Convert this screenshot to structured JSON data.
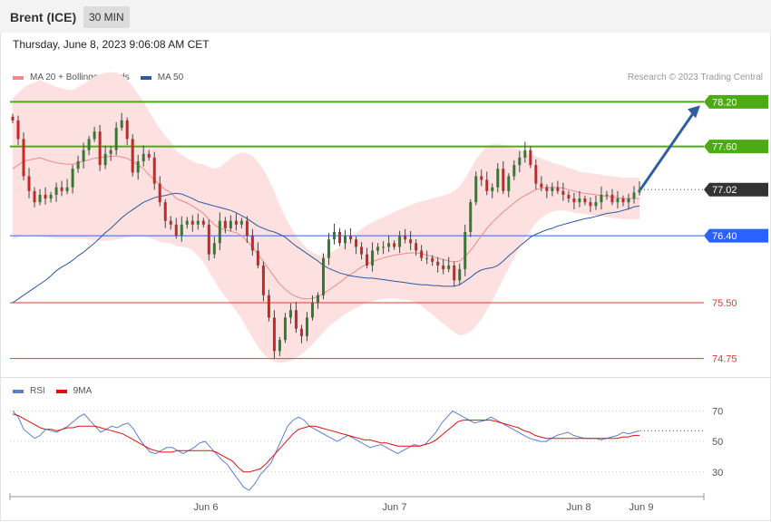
{
  "header": {
    "title": "Brent (ICE)",
    "timeframe": "30 MIN",
    "datetime": "Thursday, June 8, 2023 9:06:08 AM CET"
  },
  "legend_main": [
    {
      "label": "MA 20 + Bollinger Bands",
      "color": "#f08a8a"
    },
    {
      "label": "MA 50",
      "color": "#2c5aa0"
    }
  ],
  "copyright": "Research © 2023 Trading Central",
  "legend_rsi": [
    {
      "label": "RSI",
      "color": "#5b7fd6"
    },
    {
      "label": "9MA",
      "color": "#e01010"
    }
  ],
  "chart_data": [
    {
      "type": "candlestick",
      "title": "",
      "ylim": [
        74.55,
        78.35
      ],
      "x_ticks": [
        "Jun 6",
        "Jun 7",
        "Jun 8",
        "Jun 9"
      ],
      "levels": [
        {
          "value": 78.2,
          "label": "78.20",
          "color": "#4caa14",
          "kind": "resistance"
        },
        {
          "value": 77.6,
          "label": "77.60",
          "color": "#4caa14",
          "kind": "resistance"
        },
        {
          "value": 77.02,
          "label": "77.02",
          "color": "#333333",
          "kind": "last"
        },
        {
          "value": 76.4,
          "label": "76.40",
          "color": "#2962ff",
          "kind": "pivot"
        },
        {
          "value": 75.5,
          "label": "75.50",
          "color": "#e53935",
          "kind": "support"
        },
        {
          "value": 74.75,
          "label": "74.75",
          "color": "#e53935",
          "kind": "support"
        }
      ],
      "close": [
        77.95,
        77.7,
        77.2,
        77.0,
        76.85,
        76.95,
        76.9,
        76.95,
        77.05,
        77.0,
        77.05,
        77.3,
        77.4,
        77.55,
        77.7,
        77.8,
        77.35,
        77.5,
        77.55,
        77.85,
        77.95,
        77.7,
        77.25,
        77.4,
        77.5,
        77.45,
        77.1,
        76.85,
        76.6,
        76.55,
        76.4,
        76.55,
        76.6,
        76.55,
        76.6,
        76.55,
        76.15,
        76.3,
        76.6,
        76.5,
        76.6,
        76.55,
        76.6,
        76.4,
        76.2,
        76.0,
        75.6,
        75.3,
        74.85,
        75.0,
        75.3,
        75.4,
        75.15,
        75.05,
        75.3,
        75.5,
        75.6,
        76.1,
        76.35,
        76.45,
        76.3,
        76.4,
        76.35,
        76.25,
        76.15,
        76.0,
        76.2,
        76.25,
        76.25,
        76.3,
        76.25,
        76.4,
        76.35,
        76.3,
        76.2,
        76.1,
        76.1,
        76.05,
        76.0,
        75.95,
        76.0,
        75.8,
        75.95,
        76.45,
        76.85,
        77.2,
        77.15,
        77.0,
        77.05,
        77.3,
        77.0,
        77.2,
        77.35,
        77.45,
        77.55,
        77.35,
        77.1,
        77.05,
        77.0,
        77.05,
        77.0,
        76.95,
        76.9,
        76.85,
        76.9,
        76.85,
        76.8,
        76.85,
        76.95,
        76.95,
        76.85,
        76.9,
        76.85,
        76.9,
        76.98,
        77.02
      ],
      "ma50": [
        75.5,
        75.55,
        75.6,
        75.65,
        75.7,
        75.75,
        75.8,
        75.86,
        75.93,
        75.98,
        76.02,
        76.07,
        76.13,
        76.18,
        76.24,
        76.3,
        76.37,
        76.44,
        76.5,
        76.57,
        76.64,
        76.7,
        76.75,
        76.8,
        76.85,
        76.88,
        76.91,
        76.93,
        76.94,
        76.96,
        76.97,
        76.96,
        76.93,
        76.9,
        76.86,
        76.84,
        76.82,
        76.8,
        76.78,
        76.76,
        76.74,
        76.71,
        76.67,
        76.63,
        76.58,
        76.53,
        76.5,
        76.47,
        76.45,
        76.42,
        76.38,
        76.32,
        76.26,
        76.21,
        76.16,
        76.11,
        76.06,
        76.0,
        75.96,
        75.93,
        75.9,
        75.88,
        75.86,
        75.85,
        75.84,
        75.83,
        75.83,
        75.82,
        75.81,
        75.8,
        75.79,
        75.78,
        75.77,
        75.76,
        75.75,
        75.74,
        75.74,
        75.73,
        75.73,
        75.72,
        75.72,
        75.72,
        75.74,
        75.79,
        75.84,
        75.9,
        75.94,
        75.96,
        75.97,
        76.0,
        76.06,
        76.13,
        76.19,
        76.26,
        76.32,
        76.38,
        76.42,
        76.45,
        76.48,
        76.5,
        76.53,
        76.55,
        76.57,
        76.59,
        76.61,
        76.63,
        76.64,
        76.66,
        76.68,
        76.7,
        76.71,
        76.72,
        76.74,
        76.76,
        76.79,
        76.8
      ],
      "ma20": [
        77.3,
        77.35,
        77.4,
        77.42,
        77.43,
        77.45,
        77.42,
        77.4,
        77.38,
        77.37,
        77.36,
        77.36,
        77.38,
        77.4,
        77.42,
        77.44,
        77.45,
        77.46,
        77.47,
        77.47,
        77.46,
        77.44,
        77.4,
        77.35,
        77.3,
        77.22,
        77.15,
        77.08,
        77.02,
        76.98,
        76.9,
        76.87,
        76.84,
        76.8,
        76.75,
        76.7,
        76.62,
        76.55,
        76.5,
        76.48,
        76.46,
        76.44,
        76.4,
        76.33,
        76.25,
        76.15,
        76.05,
        75.95,
        75.85,
        75.75,
        75.68,
        75.62,
        75.58,
        75.56,
        75.55,
        75.56,
        75.58,
        75.62,
        75.67,
        75.72,
        75.77,
        75.83,
        75.88,
        75.93,
        75.98,
        76.02,
        76.05,
        76.08,
        76.1,
        76.12,
        76.14,
        76.15,
        76.16,
        76.17,
        76.17,
        76.16,
        76.14,
        76.12,
        76.1,
        76.08,
        76.06,
        76.05,
        76.06,
        76.12,
        76.2,
        76.3,
        76.4,
        76.5,
        76.58,
        76.65,
        76.72,
        76.78,
        76.84,
        76.9,
        76.94,
        76.98,
        77.02,
        77.04,
        77.05,
        77.05,
        77.05,
        77.04,
        77.02,
        77.0,
        76.98,
        76.97,
        76.96,
        76.95,
        76.94,
        76.93,
        76.92,
        76.91,
        76.9,
        76.9,
        76.9,
        76.9
      ],
      "bb_width": [
        0.95,
        0.97,
        0.99,
        1.01,
        1.03,
        1.05,
        1.04,
        1.03,
        1.02,
        1.01,
        1.0,
        1.0,
        1.02,
        1.04,
        1.07,
        1.1,
        1.12,
        1.13,
        1.13,
        1.12,
        1.1,
        1.06,
        1.01,
        0.95,
        0.9,
        0.85,
        0.8,
        0.76,
        0.72,
        0.68,
        0.64,
        0.62,
        0.6,
        0.6,
        0.62,
        0.66,
        0.7,
        0.75,
        0.82,
        0.9,
        0.98,
        1.05,
        1.12,
        1.18,
        1.22,
        1.24,
        1.24,
        1.2,
        1.14,
        1.06,
        0.98,
        0.9,
        0.82,
        0.75,
        0.68,
        0.62,
        0.56,
        0.52,
        0.49,
        0.48,
        0.48,
        0.48,
        0.49,
        0.5,
        0.51,
        0.52,
        0.53,
        0.54,
        0.55,
        0.56,
        0.58,
        0.6,
        0.62,
        0.64,
        0.67,
        0.7,
        0.74,
        0.78,
        0.82,
        0.86,
        0.9,
        0.95,
        1.0,
        1.05,
        1.09,
        1.12,
        1.12,
        1.1,
        1.05,
        0.98,
        0.9,
        0.82,
        0.74,
        0.66,
        0.58,
        0.51,
        0.45,
        0.4,
        0.36,
        0.33,
        0.31,
        0.3,
        0.29,
        0.29,
        0.28,
        0.28,
        0.28,
        0.28,
        0.28,
        0.28,
        0.28,
        0.28,
        0.28,
        0.28,
        0.28,
        0.28
      ]
    },
    {
      "type": "line",
      "title": "",
      "ylim": [
        15,
        78
      ],
      "y_ticks": [
        70,
        50,
        30
      ],
      "x_ticks": [
        "Jun 6",
        "Jun 7",
        "Jun 8",
        "Jun 9"
      ],
      "series": [
        {
          "name": "RSI",
          "color": "#5b7fd6",
          "values": [
            70,
            66,
            58,
            55,
            52,
            54,
            58,
            57,
            56,
            58,
            60,
            63,
            66,
            68,
            64,
            60,
            56,
            58,
            60,
            59,
            61,
            62,
            58,
            52,
            47,
            43,
            42,
            44,
            46,
            46,
            44,
            42,
            44,
            46,
            49,
            50,
            46,
            42,
            38,
            35,
            30,
            25,
            20,
            18,
            22,
            28,
            32,
            36,
            44,
            52,
            60,
            64,
            66,
            64,
            60,
            58,
            56,
            54,
            52,
            50,
            52,
            54,
            52,
            50,
            48,
            46,
            47,
            48,
            46,
            44,
            42,
            44,
            46,
            48,
            47,
            48,
            52,
            56,
            62,
            66,
            70,
            68,
            66,
            64,
            62,
            63,
            64,
            66,
            64,
            62,
            60,
            58,
            56,
            54,
            52,
            51,
            50,
            50,
            52,
            54,
            55,
            56,
            54,
            53,
            52,
            52,
            52,
            51,
            52,
            53,
            54,
            56,
            55,
            56,
            57
          ]
        },
        {
          "name": "9MA",
          "color": "#e01010",
          "values": [
            68,
            67,
            65,
            63,
            61,
            59,
            58,
            58,
            57,
            58,
            59,
            59,
            60,
            60,
            60,
            60,
            59,
            58,
            57,
            56,
            55,
            53,
            51,
            49,
            47,
            45,
            44,
            43,
            43,
            43,
            44,
            44,
            44,
            44,
            44,
            44,
            44,
            43,
            41,
            39,
            37,
            33,
            30,
            30,
            31,
            32,
            35,
            39,
            43,
            47,
            51,
            55,
            58,
            59,
            60,
            60,
            59,
            58,
            57,
            56,
            55,
            54,
            53,
            52,
            51,
            51,
            50,
            49,
            49,
            48,
            47,
            47,
            47,
            47,
            47,
            48,
            49,
            51,
            54,
            57,
            60,
            63,
            64,
            64,
            64,
            64,
            64,
            64,
            63,
            62,
            61,
            60,
            59,
            57,
            56,
            54,
            53,
            52,
            52,
            52,
            52,
            52,
            52,
            52,
            52,
            52,
            52,
            52,
            52,
            52,
            52,
            53,
            53,
            54,
            54
          ]
        }
      ]
    }
  ]
}
